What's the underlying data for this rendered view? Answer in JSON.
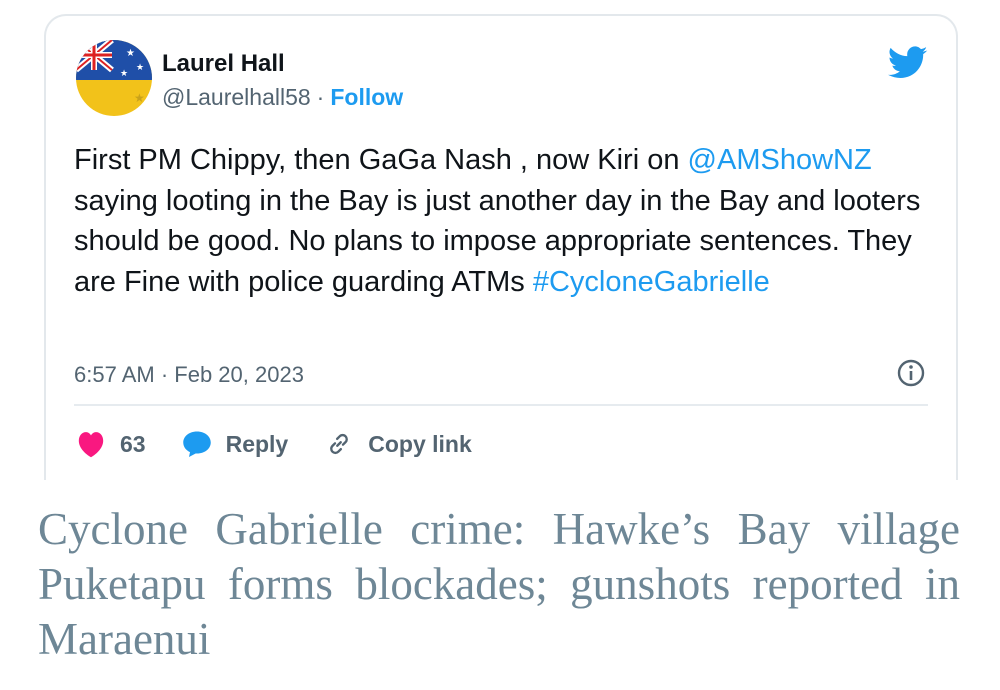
{
  "tweet": {
    "author_name": "Laurel Hall",
    "handle": "@Laurelhall58",
    "separator": "·",
    "follow_label": "Follow",
    "text": {
      "part1": "First PM Chippy, then GaGa Nash , now Kiri on ",
      "mention": "@AMShowNZ",
      "part2": " saying looting in the Bay is just another day in the Bay and looters should be good. No plans to impose appropriate sentences. They are Fine with police guarding ATMs ",
      "hashtag": "#CycloneGabrielle"
    },
    "timestamp": "6:57 AM · Feb 20, 2023",
    "likes_count": "63",
    "reply_label": "Reply",
    "copy_link_label": "Copy link",
    "colors": {
      "accent": "#1d9bf0",
      "heart": "#f91880",
      "text": "#0f1419",
      "muted": "#536471"
    },
    "icons": [
      "twitter-bird-icon",
      "info-icon",
      "heart-icon",
      "reply-bubble-icon",
      "link-icon"
    ]
  },
  "article": {
    "headline": "Cyclone Gabrielle crime: Hawke’s Bay village Puketapu forms blockades; gunshots reported in Maraenui",
    "headline_color": "#6e8796"
  }
}
